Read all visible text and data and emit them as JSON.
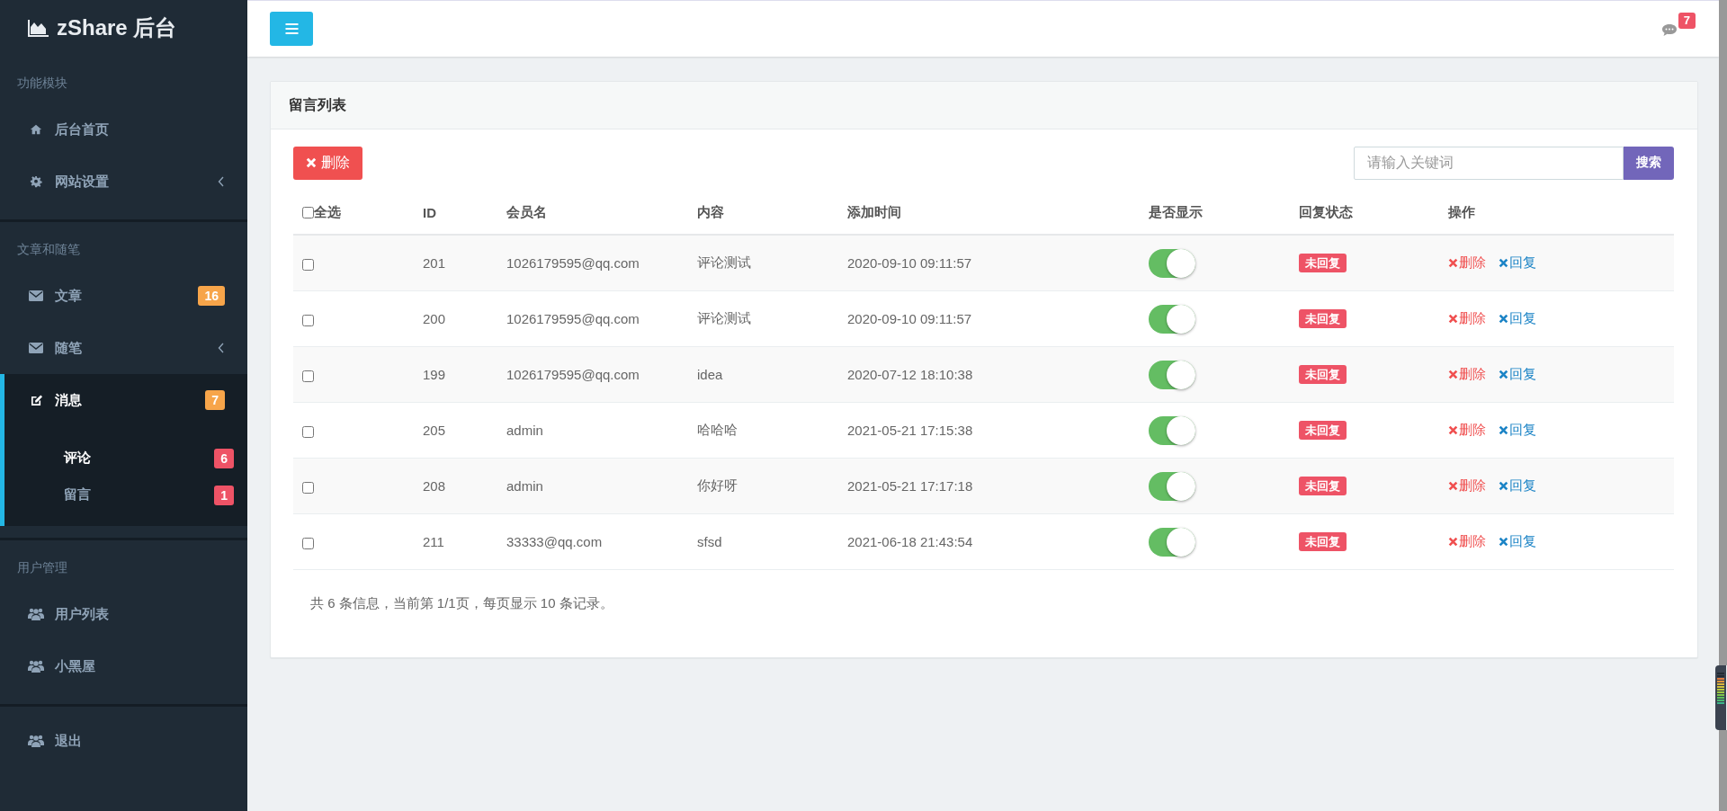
{
  "sidebar": {
    "logo": "zShare 后台",
    "sections": [
      {
        "title": "功能模块",
        "items": [
          {
            "label": "后台首页",
            "selected": false
          },
          {
            "label": "网站设置",
            "selected": false,
            "expanded": false
          }
        ]
      },
      {
        "title": "文章和随笔",
        "items": [
          {
            "label": "文章",
            "selected": false,
            "badge": "16",
            "color": "#f7a54a"
          },
          {
            "label": "随笔",
            "selected": false,
            "expanded": false
          },
          {
            "label": "消息",
            "selected": true,
            "badge": "7",
            "color": "#f7a54a",
            "expanded": true,
            "children": [
              {
                "label": "评论",
                "selected": true,
                "badge": "6",
                "color": "#ee5366"
              },
              {
                "label": "留言",
                "selected": false,
                "badge": "1",
                "color": "#ee5366"
              }
            ]
          }
        ]
      },
      {
        "title": "用户管理",
        "items": [
          {
            "label": "用户列表",
            "selected": false
          },
          {
            "label": "小黑屋",
            "selected": false
          }
        ]
      },
      {
        "items": [
          {
            "label": "退出",
            "selected": false
          }
        ]
      }
    ]
  },
  "topbar": {
    "messages_badge": "7"
  },
  "panel": {
    "title": "留言列表",
    "delete_button": "删除",
    "search": {
      "placeholder": "请输入关键词",
      "button": "搜索"
    },
    "table": {
      "select_all": {
        "label": "全选",
        "checked": false
      },
      "columns": [
        "ID",
        "会员名",
        "内容",
        "添加时间",
        "是否显示",
        "回复状态",
        "操作"
      ],
      "rows": [
        {
          "checked": false,
          "id": "201",
          "member": "1026179595@qq.com",
          "content": "评论测试",
          "time": "2020-09-10 09:11:57",
          "visible": true,
          "status": "未回复",
          "actions": [
            {
              "kind": "delete",
              "label": "删除"
            },
            {
              "kind": "reply",
              "label": "回复"
            }
          ]
        },
        {
          "checked": false,
          "id": "200",
          "member": "1026179595@qq.com",
          "content": "评论测试",
          "time": "2020-09-10 09:11:57",
          "visible": true,
          "status": "未回复",
          "actions": [
            {
              "kind": "delete",
              "label": "删除"
            },
            {
              "kind": "reply",
              "label": "回复"
            }
          ]
        },
        {
          "checked": false,
          "id": "199",
          "member": "1026179595@qq.com",
          "content": "idea",
          "time": "2020-07-12 18:10:38",
          "visible": true,
          "status": "未回复",
          "actions": [
            {
              "kind": "delete",
              "label": "删除"
            },
            {
              "kind": "reply",
              "label": "回复"
            }
          ]
        },
        {
          "checked": false,
          "id": "205",
          "member": "admin",
          "content": "哈哈哈",
          "time": "2021-05-21 17:15:38",
          "visible": true,
          "status": "未回复",
          "actions": [
            {
              "kind": "delete",
              "label": "删除"
            },
            {
              "kind": "reply",
              "label": "回复"
            }
          ]
        },
        {
          "checked": false,
          "id": "208",
          "member": "admin",
          "content": "你好呀",
          "time": "2021-05-21 17:17:18",
          "visible": true,
          "status": "未回复",
          "actions": [
            {
              "kind": "delete",
              "label": "删除"
            },
            {
              "kind": "reply",
              "label": "回复"
            }
          ]
        },
        {
          "checked": false,
          "id": "211",
          "member": "33333@qq.com",
          "content": "sfsd",
          "time": "2021-06-18 21:43:54",
          "visible": true,
          "status": "未回复",
          "actions": [
            {
              "kind": "delete",
              "label": "删除"
            },
            {
              "kind": "reply",
              "label": "回复"
            }
          ]
        }
      ]
    },
    "footer": "共 6 条信息，当前第 1/1页，每页显示 10 条记录。"
  }
}
